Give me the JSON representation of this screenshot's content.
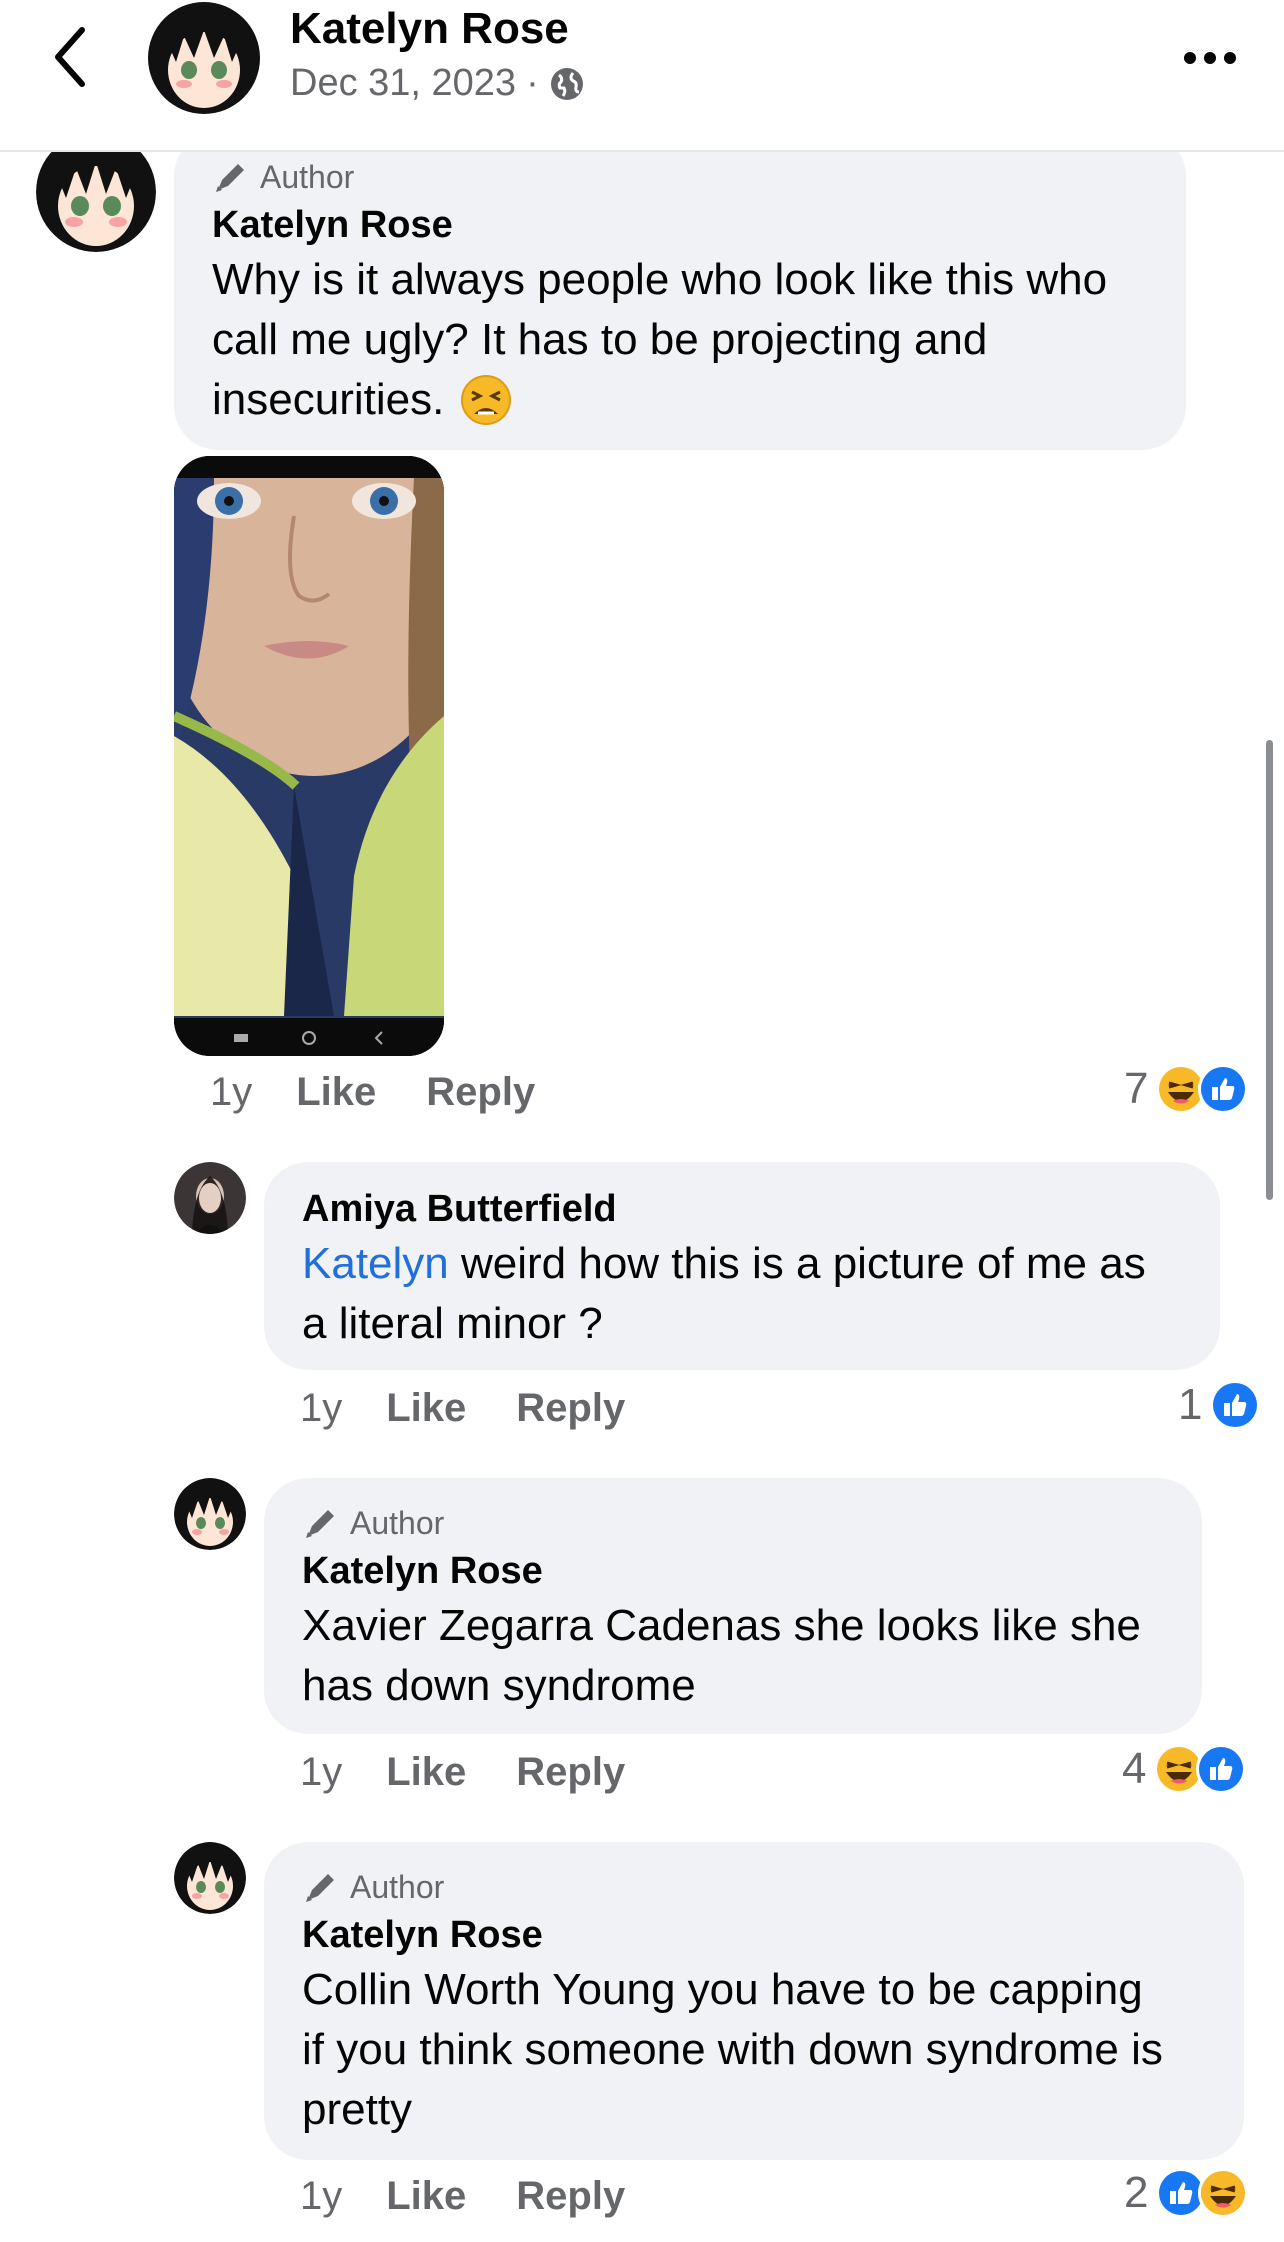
{
  "header": {
    "name": "Katelyn Rose",
    "date": "Dec 31, 2023",
    "separator": "·"
  },
  "comments": [
    {
      "author_tag": "Author",
      "name": "Katelyn Rose",
      "text_lines": [
        "Why is it always people who look like this who",
        "call me ugly? It has to be projecting and",
        "insecurities."
      ],
      "emoji": "tired-face",
      "time": "1y",
      "like": "Like",
      "reply": "Reply",
      "reaction_count": "7",
      "reactions": [
        "haha",
        "like"
      ]
    },
    {
      "name": "Amiya Butterfield",
      "mention": "Katelyn",
      "text_lines": [
        " weird how this is a picture of me as",
        "a literal minor ?"
      ],
      "time": "1y",
      "like": "Like",
      "reply": "Reply",
      "reaction_count": "1",
      "reactions": [
        "like"
      ]
    },
    {
      "author_tag": "Author",
      "name": "Katelyn Rose",
      "text_lines": [
        "Xavier Zegarra Cadenas she looks like she",
        "has down syndrome"
      ],
      "time": "1y",
      "like": "Like",
      "reply": "Reply",
      "reaction_count": "4",
      "reactions": [
        "haha",
        "like"
      ]
    },
    {
      "author_tag": "Author",
      "name": "Katelyn Rose",
      "text_lines": [
        "Collin Worth Young you have to be capping",
        "if you think someone with down syndrome is",
        "pretty"
      ],
      "time": "1y",
      "like": "Like",
      "reply": "Reply",
      "reaction_count": "2",
      "reactions": [
        "like",
        "haha"
      ]
    }
  ],
  "colors": {
    "bubble": "#f0f2f5",
    "like_blue": "#1877f2",
    "haha_yellow": "#f7b928",
    "meta_gray": "#65676b",
    "mention_blue": "#216fdb"
  }
}
